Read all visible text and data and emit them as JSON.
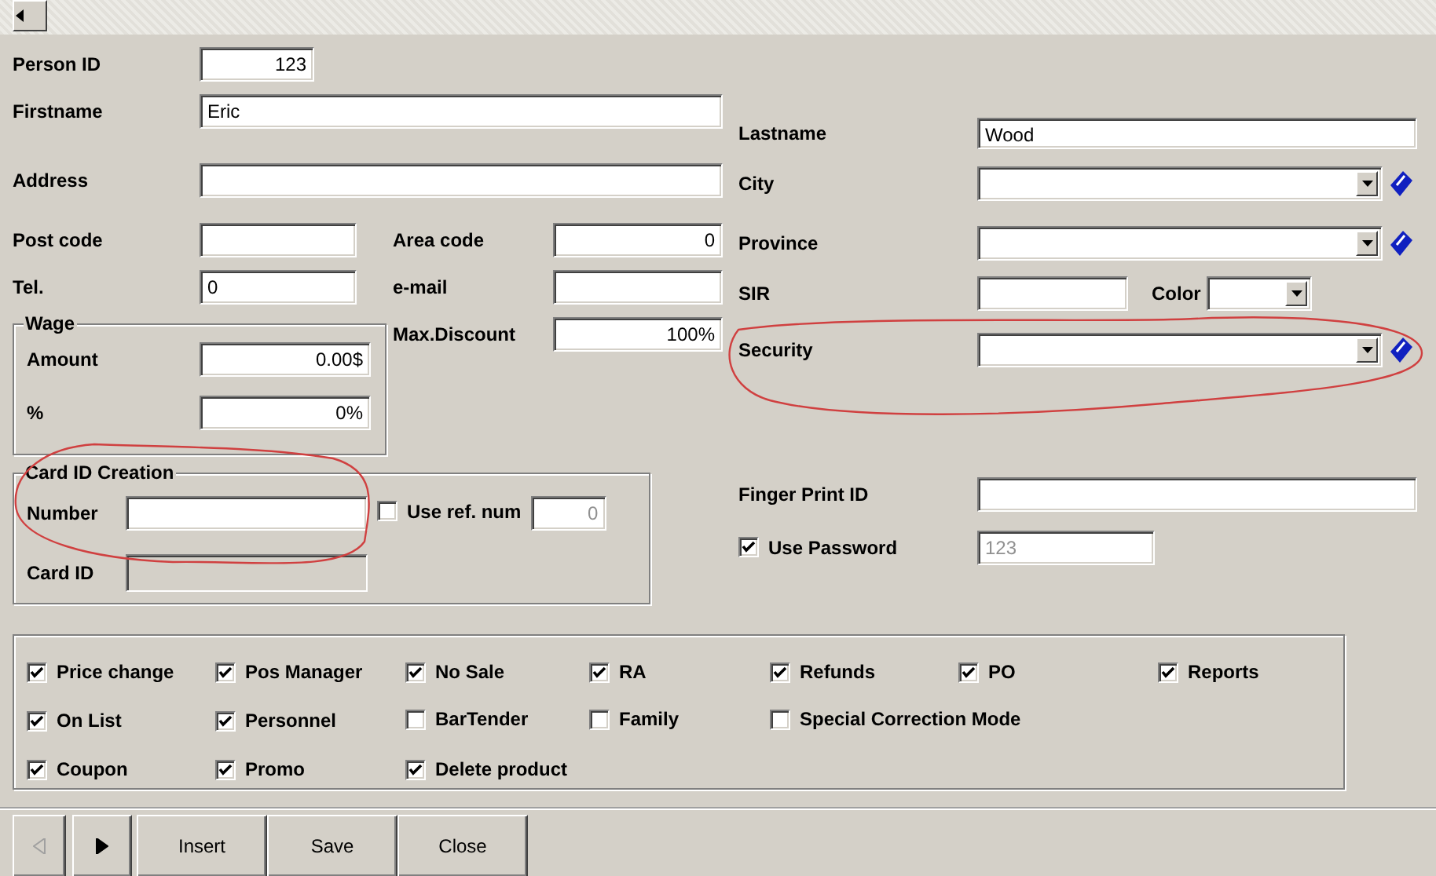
{
  "person_id": {
    "label": "Person ID",
    "value": "123"
  },
  "firstname": {
    "label": "Firstname",
    "value": "Eric"
  },
  "lastname": {
    "label": "Lastname",
    "value": "Wood"
  },
  "address": {
    "label": "Address"
  },
  "city": {
    "label": "City",
    "lookup_button": true
  },
  "post_code": {
    "label": "Post code"
  },
  "area_code": {
    "label": "Area code",
    "value": "0"
  },
  "province": {
    "label": "Province",
    "lookup_button": true
  },
  "tel": {
    "label": "Tel.",
    "value": "0"
  },
  "email": {
    "label": "e-mail"
  },
  "sir": {
    "label": "SIR"
  },
  "color": {
    "label": "Color"
  },
  "wage": {
    "title": "Wage",
    "amount": {
      "label": "Amount",
      "value": "0.00$"
    },
    "percent": {
      "label": "%",
      "value": "0%"
    }
  },
  "max_discount": {
    "label": "Max.Discount",
    "value": "100%"
  },
  "security": {
    "label": "Security",
    "lookup_button": true
  },
  "card_id_creation": {
    "title": "Card ID Creation",
    "number": {
      "label": "Number"
    },
    "use_ref_num": {
      "label": "Use ref. num",
      "checked": false,
      "value": "0",
      "disabled": true
    },
    "card_id": {
      "label": "Card ID",
      "read_only": true
    }
  },
  "finger_print_id": {
    "label": "Finger Print ID"
  },
  "use_password": {
    "label": "Use Password",
    "checked": true,
    "value": "123",
    "disabled": true
  },
  "permissions": [
    [
      {
        "label": "Price change",
        "checked": true
      },
      {
        "label": "Pos Manager",
        "checked": true
      },
      {
        "label": "No Sale",
        "checked": true
      },
      {
        "label": "RA",
        "checked": true
      },
      {
        "label": "Refunds",
        "checked": true
      },
      {
        "label": "PO",
        "checked": true
      },
      {
        "label": "Reports",
        "checked": true
      }
    ],
    [
      {
        "label": "On List",
        "checked": true
      },
      {
        "label": "Personnel",
        "checked": true
      },
      {
        "label": "BarTender",
        "checked": false
      },
      {
        "label": "Family",
        "checked": false
      },
      {
        "label": "Special Correction Mode",
        "checked": false
      }
    ],
    [
      {
        "label": "Coupon",
        "checked": true
      },
      {
        "label": "Promo",
        "checked": true
      },
      {
        "label": "Delete product",
        "checked": true
      }
    ]
  ],
  "nav": [
    {
      "kind": "previous",
      "disabled": true
    },
    {
      "kind": "next",
      "disabled": false
    }
  ],
  "buttons": [
    {
      "label": "Insert"
    },
    {
      "label": "Save"
    },
    {
      "label": "Close"
    }
  ]
}
